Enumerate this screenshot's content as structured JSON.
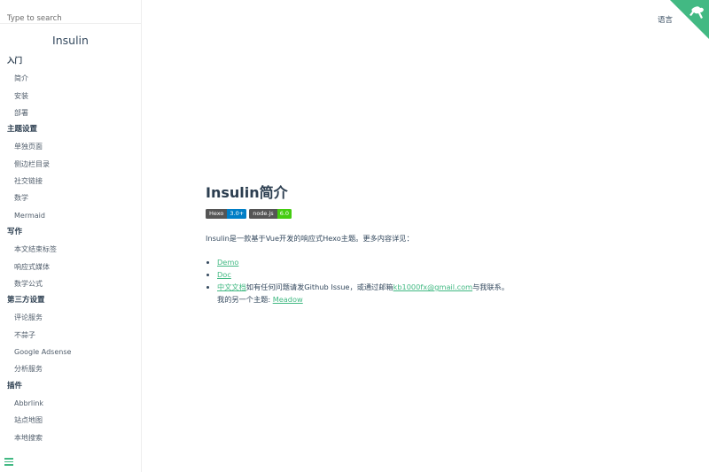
{
  "search": {
    "placeholder": "Type to search"
  },
  "app_name": "Insulin",
  "nav": [
    {
      "title": "入门",
      "items": [
        "简介",
        "安装",
        "部署"
      ]
    },
    {
      "title": "主题设置",
      "items": [
        "单独页面",
        "侧边栏目录",
        "社交链接",
        "数学",
        "Mermaid"
      ]
    },
    {
      "title": "写作",
      "items": [
        "本文结束标签",
        "响应式媒体",
        "数学公式"
      ]
    },
    {
      "title": "第三方设置",
      "items": [
        "评论服务",
        "不蒜子",
        "Google Adsense",
        "分析服务"
      ]
    },
    {
      "title": "插件",
      "items": [
        "Abbrlink",
        "站点地图",
        "本地搜索"
      ]
    }
  ],
  "header": {
    "language_label": "语言"
  },
  "article": {
    "title": "Insulin简介",
    "badges": [
      {
        "left": "Hexo",
        "right": "3.0+",
        "color": "#007ec6"
      },
      {
        "left": "node.js",
        "right": "6.0",
        "color": "#4c1"
      }
    ],
    "description": "Insulin是一款基于Vue开发的响应式Hexo主题。更多内容详见：",
    "links": {
      "demo": "Demo",
      "doc": "Doc",
      "cn_doc": "中文文档",
      "issue_text": "如有任何问题请发Github Issue，或通过邮箱",
      "email": "kb1000fx@gmail.com",
      "contact_suffix": "与我联系。",
      "other_theme_prefix": "我的另一个主题: ",
      "other_theme": "Meadow"
    }
  },
  "colors": {
    "accent": "#42b983",
    "text": "#34495e"
  },
  "icons": {
    "corner": "github-corner-icon",
    "menu": "hamburger-menu-icon"
  }
}
